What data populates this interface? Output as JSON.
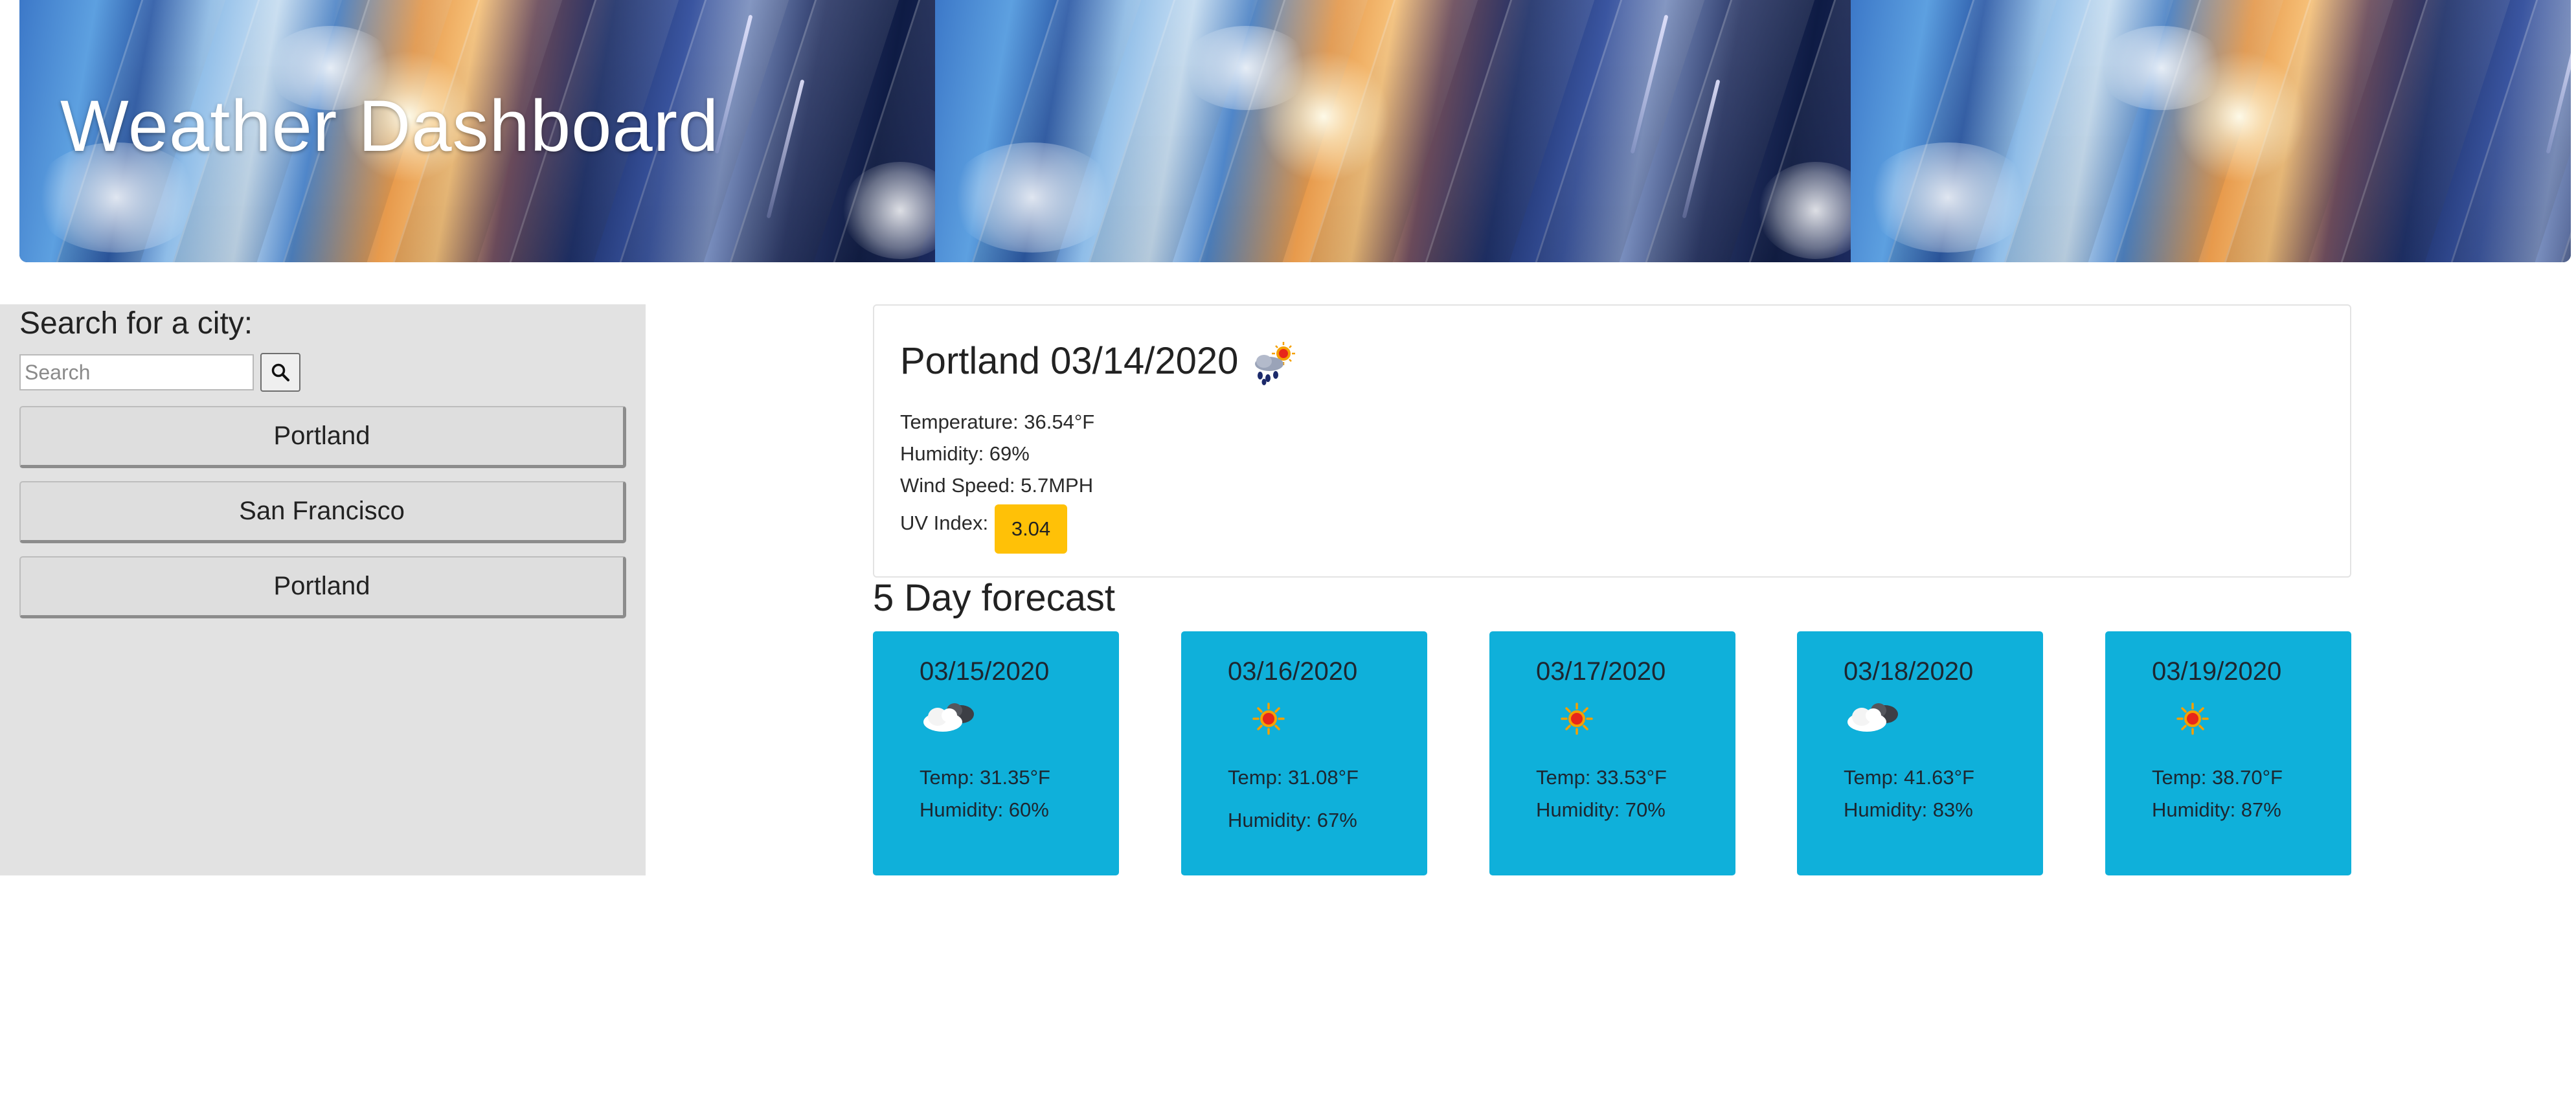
{
  "header": {
    "title": "Weather Dashboard"
  },
  "sidebar": {
    "heading": "Search for a city:",
    "search": {
      "placeholder": "Search",
      "value": "",
      "button_icon": "search-icon"
    },
    "history": [
      {
        "label": "Portland"
      },
      {
        "label": "San Francisco"
      },
      {
        "label": "Portland"
      }
    ]
  },
  "current": {
    "title": "Portland 03/14/2020",
    "icon": "rain-sun-icon",
    "temperature": "Temperature: 36.54°F",
    "humidity": "Humidity: 69%",
    "wind": "Wind Speed: 5.7MPH",
    "uv_label": "UV Index:",
    "uv_value": "3.04",
    "uv_color": "#ffc107"
  },
  "forecast": {
    "heading": "5 Day forecast",
    "card_color": "#0fb0da",
    "days": [
      {
        "date": "03/15/2020",
        "icon": "cloudy-icon",
        "temp": "Temp: 31.35°F",
        "humidity": "Humidity: 60%"
      },
      {
        "date": "03/16/2020",
        "icon": "sun-icon",
        "temp": "Temp: 31.08°F",
        "humidity": "Humidity: 67%"
      },
      {
        "date": "03/17/2020",
        "icon": "sun-icon",
        "temp": "Temp: 33.53°F",
        "humidity": "Humidity: 70%"
      },
      {
        "date": "03/18/2020",
        "icon": "cloudy-icon",
        "temp": "Temp: 41.63°F",
        "humidity": "Humidity: 83%"
      },
      {
        "date": "03/19/2020",
        "icon": "sun-icon",
        "temp": "Temp: 38.70°F",
        "humidity": "Humidity: 87%"
      }
    ]
  }
}
